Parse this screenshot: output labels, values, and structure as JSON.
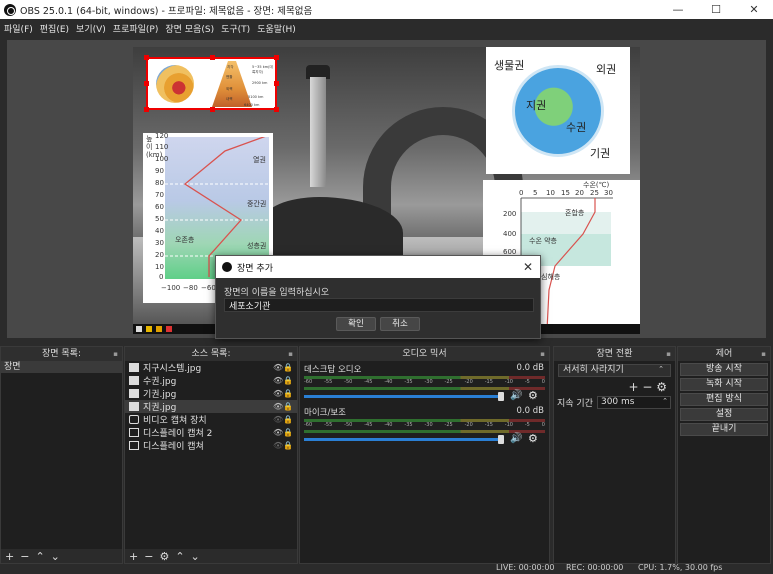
{
  "window": {
    "title": "OBS 25.0.1 (64-bit, windows) - 프로파일: 제목없음 - 장면: 제목없음",
    "min": "—",
    "max": "☐",
    "close": "✕"
  },
  "menu": [
    "파일(F)",
    "편집(E)",
    "보기(V)",
    "프로파일(P)",
    "장면 모음(S)",
    "도구(T)",
    "도움말(H)"
  ],
  "preview": {
    "earth_captions": [
      "5~35 km(대륙지각)",
      "2900 km",
      "5100 km",
      "6400 km",
      "지각",
      "맨틀",
      "외핵",
      "내핵"
    ],
    "atmo": {
      "axis_title": "높이(km)",
      "y_ticks": [
        "120",
        "110",
        "100",
        "90",
        "80",
        "70",
        "60",
        "50",
        "40",
        "30",
        "20",
        "10",
        "0"
      ],
      "x_ticks": [
        "−100",
        "−80",
        "−60"
      ],
      "layers": [
        "열권",
        "중간권",
        "오존층",
        "성층권"
      ]
    },
    "sphere": {
      "labels": [
        "생물권",
        "외권",
        "지권",
        "수권",
        "기권"
      ]
    },
    "ocean": {
      "axis_title": "수온(℃)",
      "x_ticks": [
        "0",
        "5",
        "10",
        "15",
        "20",
        "25",
        "30"
      ],
      "y_ticks": [
        "200",
        "400",
        "600"
      ],
      "layers": [
        "혼합층",
        "수온 약층",
        "심해층"
      ]
    }
  },
  "dialog": {
    "title": "장면 추가",
    "prompt": "장면의 이름을 입력하십시오",
    "value": "세포소기관",
    "ok": "확인",
    "cancel": "취소",
    "close": "✕"
  },
  "docks": {
    "scenes": {
      "title": "장면 목록:",
      "items": [
        "장면"
      ]
    },
    "sources": {
      "title": "소스 목록:",
      "items": [
        {
          "name": "지구시스템.jpg",
          "type": "image"
        },
        {
          "name": "수권.jpg",
          "type": "image"
        },
        {
          "name": "기권.jpg",
          "type": "image"
        },
        {
          "name": "지권.jpg",
          "type": "image"
        },
        {
          "name": "비디오 캡쳐 장치",
          "type": "camera"
        },
        {
          "name": "디스플레이 캡쳐 2",
          "type": "display"
        },
        {
          "name": "디스플레이 캡쳐",
          "type": "display"
        }
      ]
    },
    "mixer": {
      "title": "오디오 믹서",
      "channels": [
        {
          "name": "데스크탑 오디오",
          "db": "0.0 dB"
        },
        {
          "name": "마이크/보조",
          "db": "0.0 dB"
        }
      ],
      "ticks": [
        "-60",
        "-55",
        "-50",
        "-45",
        "-40",
        "-35",
        "-30",
        "-25",
        "-20",
        "-15",
        "-10",
        "-5",
        "0"
      ]
    },
    "transitions": {
      "title": "장면 전환",
      "selected": "서서히 사라지기",
      "duration_label": "지속 기간",
      "duration": "300 ms"
    },
    "controls": {
      "title": "제어",
      "buttons": [
        "방송 시작",
        "녹화 시작",
        "편집 방식",
        "설정",
        "끝내기"
      ]
    }
  },
  "status": {
    "live": "LIVE: 00:00:00",
    "rec": "REC: 00:00:00",
    "cpu": "CPU: 1.7%, 30.00 fps"
  }
}
